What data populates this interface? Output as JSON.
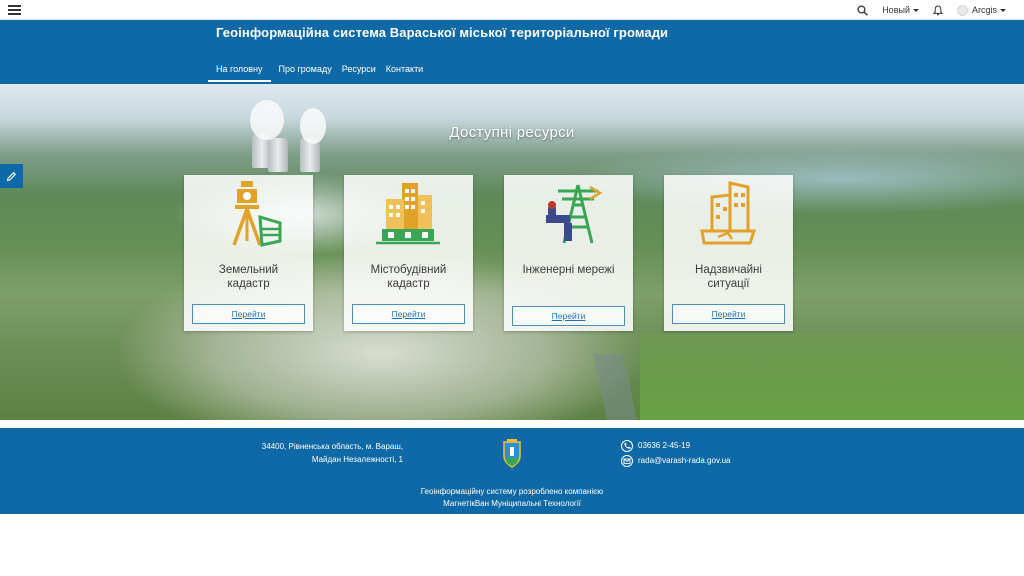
{
  "topbar": {
    "new_label": "Новый",
    "user_label": "Arcgis",
    "icons": [
      "hamburger-menu-icon",
      "search-icon",
      "bell-icon",
      "avatar"
    ]
  },
  "header": {
    "title": "Геоінформаційна система Вараської міської територіальної громади"
  },
  "nav": {
    "home": "На головну",
    "about": "Про громаду",
    "resources": "Ресурси",
    "contacts": "Контакти"
  },
  "hero": {
    "title": "Доступні ресурси"
  },
  "cards": [
    {
      "line1": "Земельний",
      "line2": "кадастр",
      "button": "Перейти"
    },
    {
      "line1": "Містобудівний",
      "line2": "кадастр",
      "button": "Перейти"
    },
    {
      "line1": "Інженерні мережі",
      "line2": "",
      "button": "Перейти"
    },
    {
      "line1": "Надзвичайні",
      "line2": "ситуації",
      "button": "Перейти"
    }
  ],
  "footer": {
    "address_line1": "34400, Рівненська область, м. Вараш,",
    "address_line2": "Майдан Незалежності, 1",
    "phone": "03636 2-45-19",
    "email": "rada@varash-rada.gov.ua",
    "credit_line1": "Геоінформаційну систему розроблено компанією",
    "credit_line2": "МагнетікВан Муніципальні Технології"
  },
  "colors": {
    "brand_blue": "#0e69a6",
    "icon_gold": "#e1a22a",
    "icon_green": "#3aa655"
  }
}
